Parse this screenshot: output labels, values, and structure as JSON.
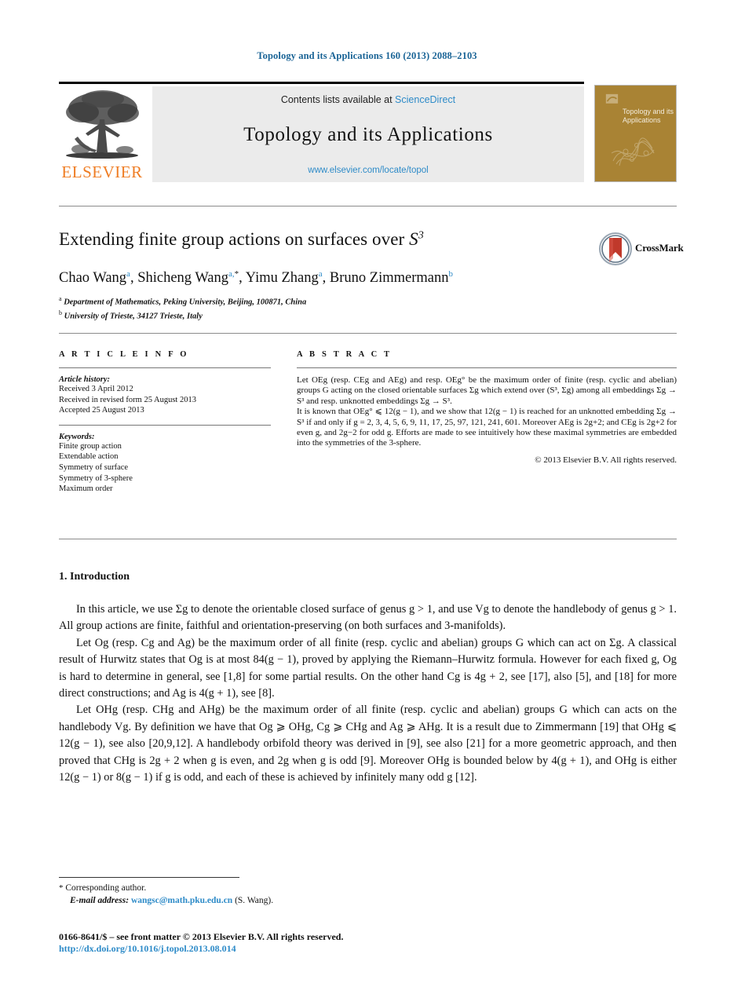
{
  "running_head": "Topology and its Applications 160 (2013) 2088–2103",
  "masthead": {
    "contents_prefix": "Contents lists available at ",
    "sciencedirect": "ScienceDirect",
    "journal_title": "Topology and its Applications",
    "journal_url": "www.elsevier.com/locate/topol",
    "publisher": "ELSEVIER",
    "cover_title": "Topology and its Applications",
    "accent_orange": "#ef7d24",
    "link_blue": "#2e8bc8",
    "cover_gold": "#a98334"
  },
  "title": {
    "main": "Extending finite group actions on surfaces over ",
    "math": "S",
    "math_sup": "3"
  },
  "authors": {
    "list": "Chao Wang",
    "a1": "a",
    "name2": ", Shicheng Wang",
    "a2": "a,",
    "star": "*",
    "name3": ", Yimu Zhang",
    "a3": "a",
    "name4": ", Bruno Zimmermann",
    "a4": "b"
  },
  "affiliations": [
    {
      "mark": "a",
      "text": "Department of Mathematics, Peking University, Beijing, 100871, China"
    },
    {
      "mark": "b",
      "text": "University of Trieste, 34127 Trieste, Italy"
    }
  ],
  "crossmark": {
    "label": "CrossMark"
  },
  "info": {
    "heading": "A R T I C L E  I N F O",
    "history_label": "Article history:",
    "history_lines": [
      "Received 3 April 2012",
      "Received in revised form 25 August 2013",
      "Accepted 25 August 2013"
    ],
    "keywords_label": "Keywords:",
    "keywords": [
      "Finite group action",
      "Extendable action",
      "Symmetry of surface",
      "Symmetry of 3-sphere",
      "Maximum order"
    ]
  },
  "abstract": {
    "heading": "A B S T R A C T",
    "paragraph1": "Let OEg (resp. CEg and AEg) and resp. OEg° be the maximum order of finite (resp. cyclic and abelian) groups G acting on the closed orientable surfaces Σg which extend over (S³, Σg) among all embeddings Σg → S³ and resp. unknotted embeddings Σg → S³.",
    "paragraph2": "It is known that OEg° ⩽ 12(g − 1), and we show that 12(g − 1) is reached for an unknotted embedding Σg → S³ if and only if g = 2, 3, 4, 5, 6, 9, 11, 17, 25, 97, 121, 241, 601. Moreover AEg is 2g+2; and CEg is 2g+2 for even g, and 2g−2 for odd g. Efforts are made to see intuitively how these maximal symmetries are embedded into the symmetries of the 3-sphere.",
    "copyright": "© 2013 Elsevier B.V. All rights reserved."
  },
  "body": {
    "section_number_title": "1. Introduction",
    "paragraph1": "In this article, we use Σg to denote the orientable closed surface of genus g > 1, and use Vg to denote the handlebody of genus g > 1. All group actions are finite, faithful and orientation-preserving (on both surfaces and 3-manifolds).",
    "paragraph2": "Let Og (resp. Cg and Ag) be the maximum order of all finite (resp. cyclic and abelian) groups G which can act on Σg. A classical result of Hurwitz states that Og is at most 84(g − 1), proved by applying the Riemann–Hurwitz formula. However for each fixed g, Og is hard to determine in general, see [1,8] for some partial results. On the other hand Cg is 4g + 2, see [17], also [5], and [18] for more direct constructions; and Ag is 4(g + 1), see [8].",
    "paragraph3": "Let OHg (resp. CHg and AHg) be the maximum order of all finite (resp. cyclic and abelian) groups G which can acts on the handlebody Vg. By definition we have that Og ⩾ OHg, Cg ⩾ CHg and Ag ⩾ AHg. It is a result due to Zimmermann [19] that OHg ⩽ 12(g − 1), see also [20,9,12]. A handlebody orbifold theory was derived in [9], see also [21] for a more geometric approach, and then proved that CHg is 2g + 2 when g is even, and 2g when g is odd [9]. Moreover OHg is bounded below by 4(g + 1), and OHg is either 12(g − 1) or 8(g − 1) if g is odd, and each of these is achieved by infinitely many odd g [12]."
  },
  "footnotes": {
    "corresponding_mark": "*",
    "corresponding": "Corresponding author.",
    "email_label": "E-mail address:",
    "email": "wangsc@math.pku.edu.cn",
    "email_owner": "(S. Wang).",
    "issn_line": "0166-8641/$ – see front matter  © 2013 Elsevier B.V. All rights reserved.",
    "doi": "http://dx.doi.org/10.1016/j.topol.2013.08.014"
  }
}
